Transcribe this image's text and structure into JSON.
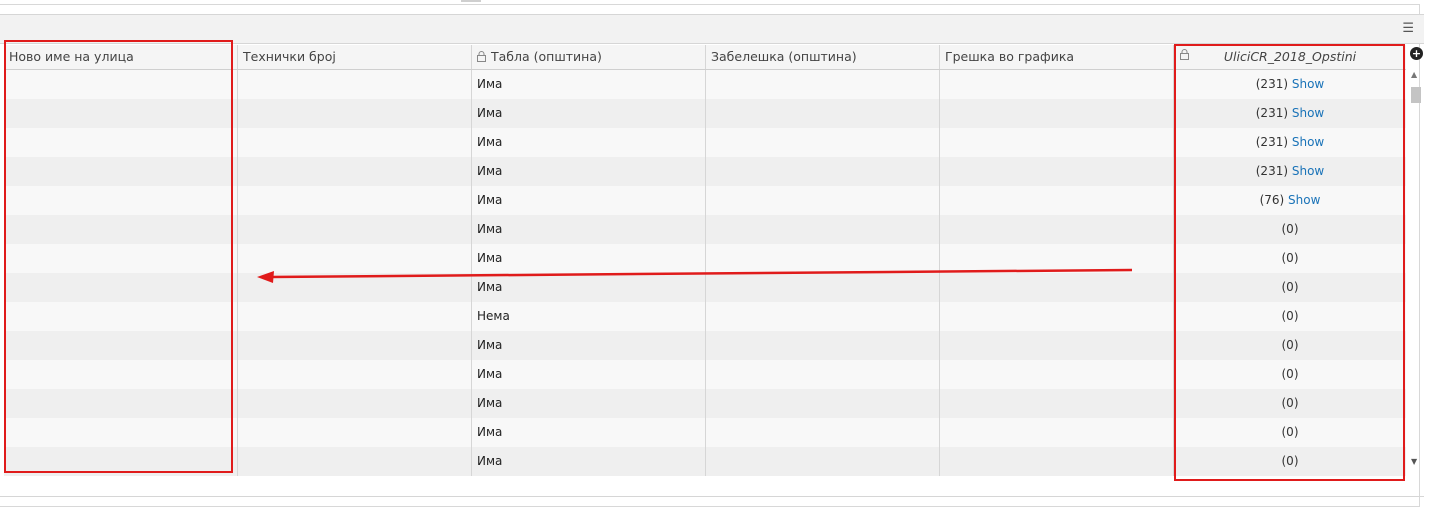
{
  "toolbar": {
    "menu_icon": "hamburger-icon",
    "menu_glyph": "☰"
  },
  "grid": {
    "columns": [
      {
        "label": "Ново име на улица",
        "locked": false
      },
      {
        "label": "Технички број",
        "locked": false
      },
      {
        "label": "Табла (општина)",
        "locked": true
      },
      {
        "label": "Забелешка (општина)",
        "locked": false
      },
      {
        "label": "Грешка во графика",
        "locked": false
      },
      {
        "label": "UliciCR_2018_Opstini",
        "locked": true
      }
    ],
    "rows": [
      {
        "tabla": "Има",
        "count": "(231)",
        "show": "Show"
      },
      {
        "tabla": "Има",
        "count": "(231)",
        "show": "Show"
      },
      {
        "tabla": "Има",
        "count": "(231)",
        "show": "Show"
      },
      {
        "tabla": "Има",
        "count": "(231)",
        "show": "Show"
      },
      {
        "tabla": "Има",
        "count": "(76)",
        "show": "Show"
      },
      {
        "tabla": "Има",
        "count": "(0)",
        "show": ""
      },
      {
        "tabla": "Има",
        "count": "(0)",
        "show": ""
      },
      {
        "tabla": "Има",
        "count": "(0)",
        "show": ""
      },
      {
        "tabla": "Нема",
        "count": "(0)",
        "show": ""
      },
      {
        "tabla": "Има",
        "count": "(0)",
        "show": ""
      },
      {
        "tabla": "Има",
        "count": "(0)",
        "show": ""
      },
      {
        "tabla": "Има",
        "count": "(0)",
        "show": ""
      },
      {
        "tabla": "Има",
        "count": "(0)",
        "show": ""
      },
      {
        "tabla": "Има",
        "count": "(0)",
        "show": ""
      }
    ]
  },
  "controls": {
    "add_column_icon": "plus-circle-icon",
    "add_glyph": "+",
    "scroll_up": "▲",
    "scroll_down": "▼"
  },
  "colors": {
    "annotation_red": "#e01b1b",
    "link_blue": "#1a73b8"
  }
}
